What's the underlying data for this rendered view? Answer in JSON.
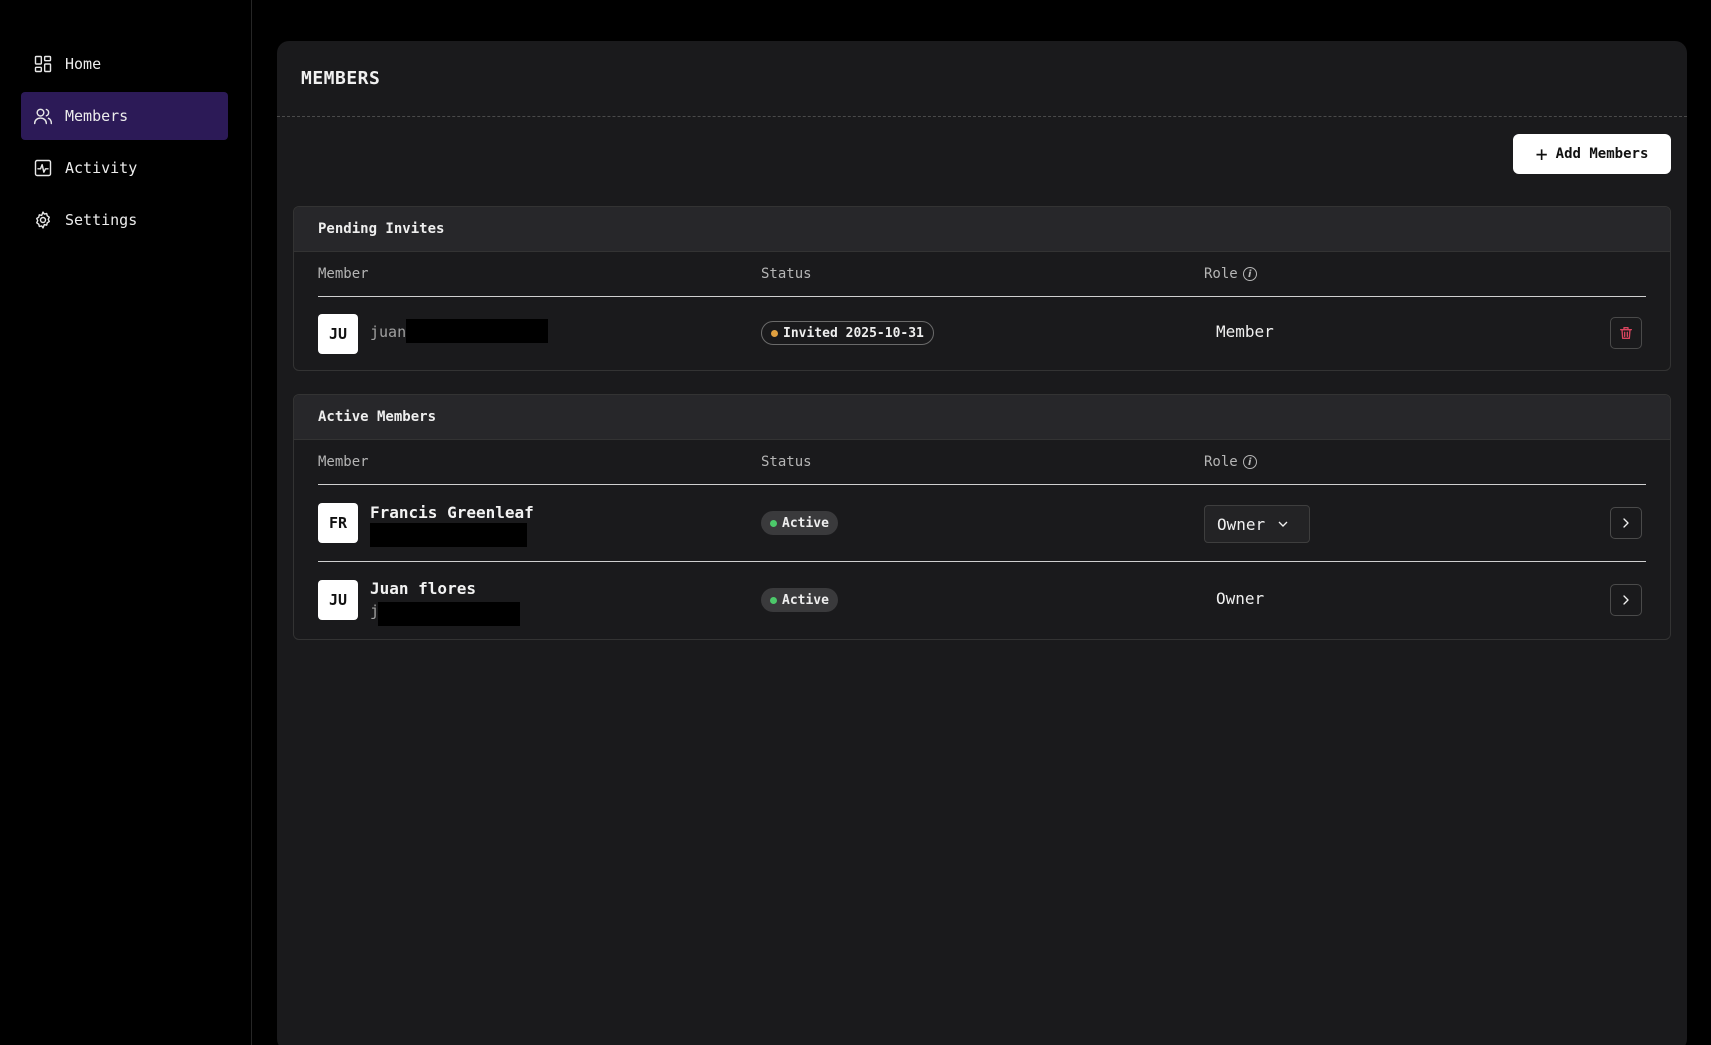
{
  "sidebar": {
    "items": [
      {
        "label": "Home",
        "icon": "dashboard-grid-icon",
        "active": false
      },
      {
        "label": "Members",
        "icon": "users-icon",
        "active": true
      },
      {
        "label": "Activity",
        "icon": "activity-icon",
        "active": false
      },
      {
        "label": "Settings",
        "icon": "gear-icon",
        "active": false
      }
    ]
  },
  "header": {
    "title": "MEMBERS"
  },
  "toolbar": {
    "add_members_label": "Add Members"
  },
  "pending": {
    "title": "Pending Invites",
    "columns": {
      "member": "Member",
      "status": "Status",
      "role": "Role"
    },
    "rows": [
      {
        "initials": "JU",
        "email_prefix": "juan",
        "status": "Invited 2025-10-31",
        "status_color": "#e0a040",
        "role": "Member"
      }
    ]
  },
  "active": {
    "title": "Active Members",
    "columns": {
      "member": "Member",
      "status": "Status",
      "role": "Role"
    },
    "rows": [
      {
        "initials": "FR",
        "name": "Francis Greenleaf",
        "email_prefix": "",
        "status": "Active",
        "status_color": "#4cc96a",
        "role": "Owner"
      },
      {
        "initials": "JU",
        "name": "Juan flores",
        "email_prefix": "j",
        "status": "Active",
        "status_color": "#4cc96a",
        "role": "Owner"
      }
    ]
  },
  "colors": {
    "accent_nav_active": "#2c1a57",
    "delete_icon": "#d9455f",
    "panel_bg": "#1a1a1c"
  }
}
